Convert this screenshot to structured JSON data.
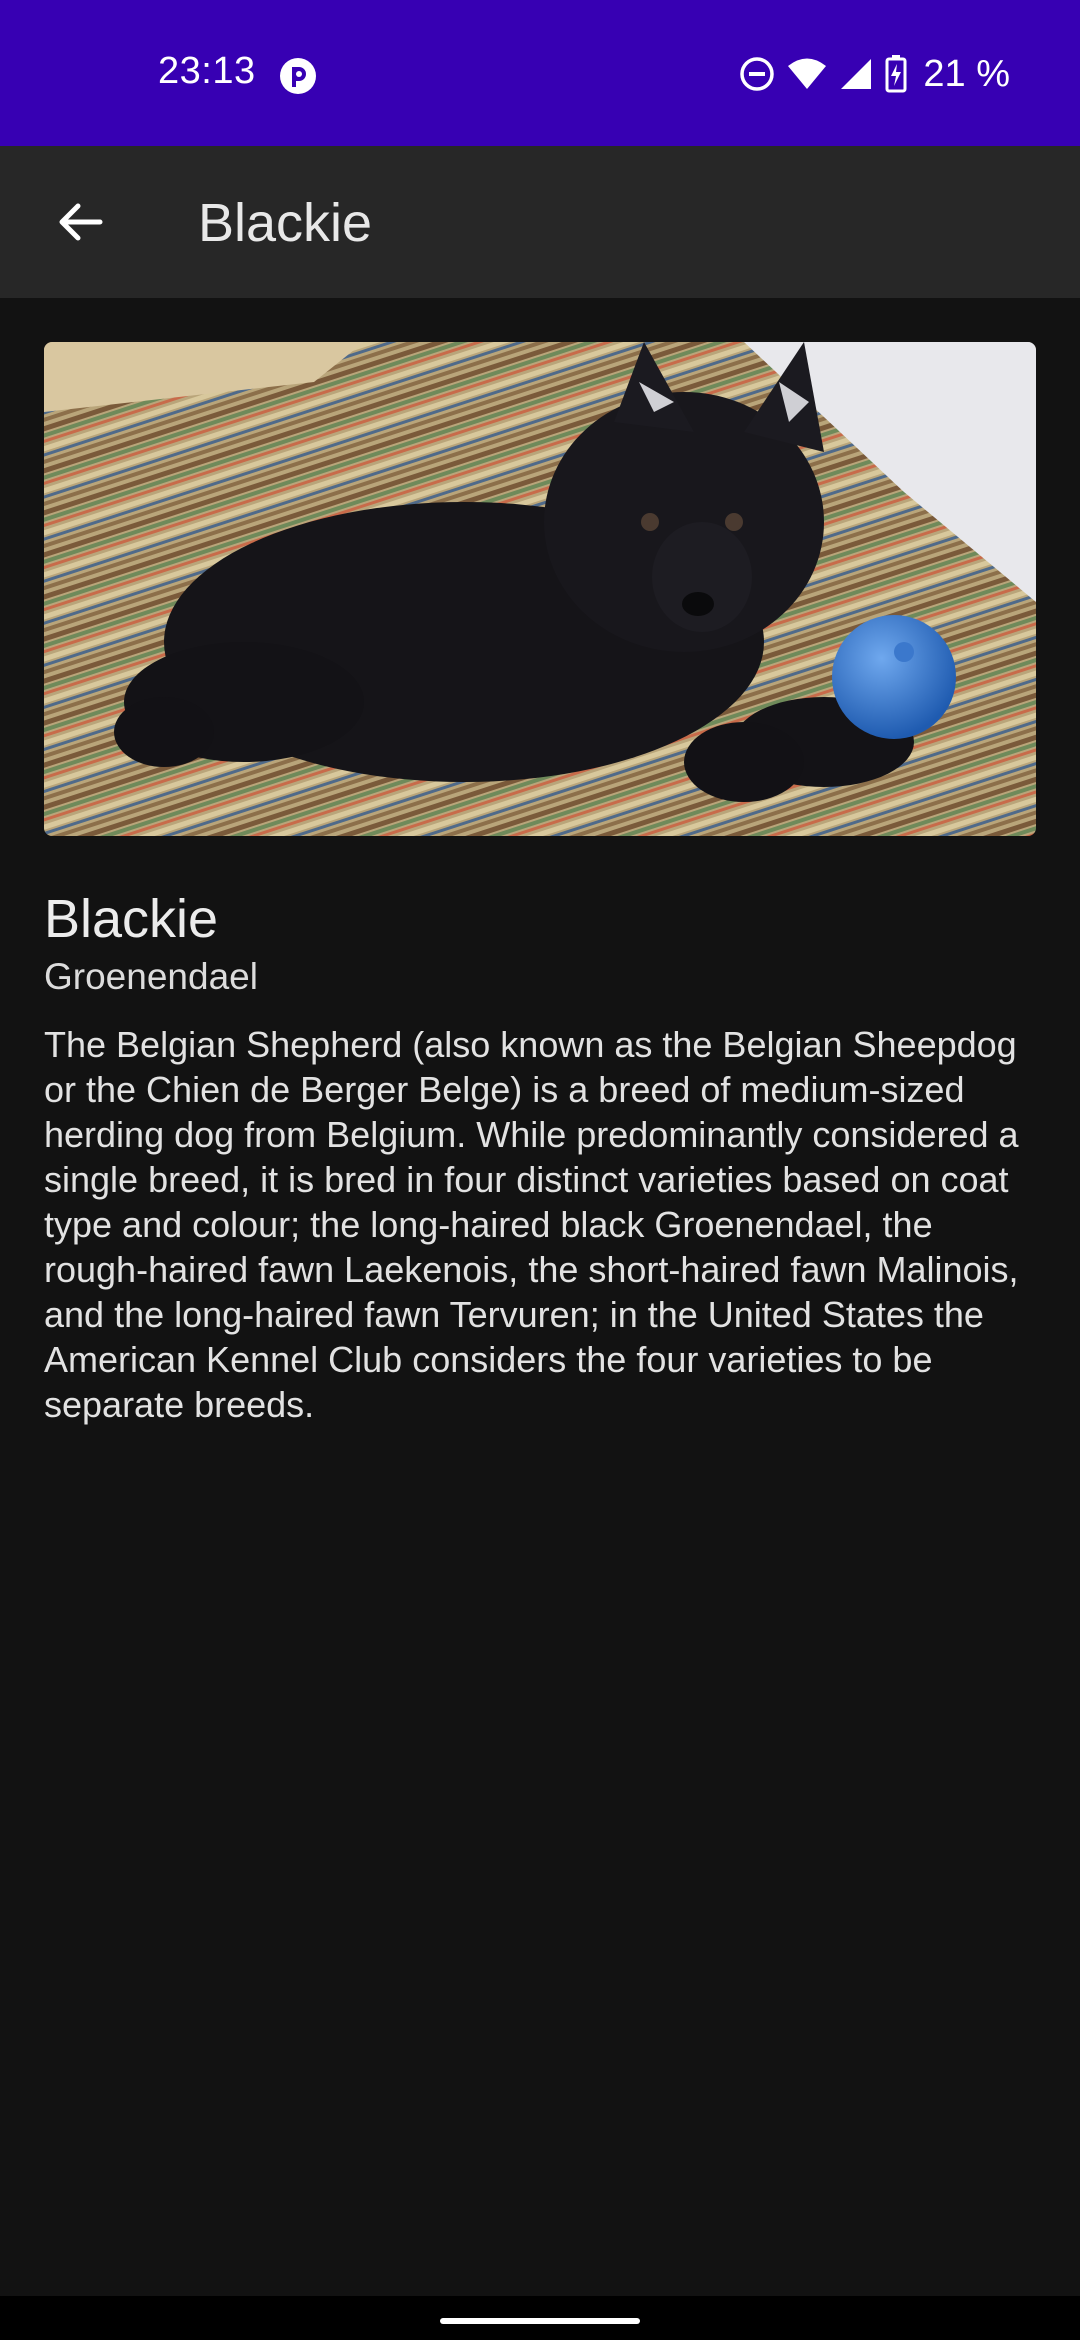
{
  "status_bar": {
    "time": "23:13",
    "battery": "21 %",
    "background": "#3700b3",
    "icons": [
      "app-notification-icon",
      "do-not-disturb-icon",
      "wifi-icon",
      "cell-signal-icon",
      "battery-charging-icon"
    ]
  },
  "app_bar": {
    "title": "Blackie",
    "back_icon": "arrow-back-icon"
  },
  "detail": {
    "photo_subject": "black puppy lying on striped rug with a blue ball",
    "name": "Blackie",
    "breed": "Groenendael",
    "description": "The Belgian Shepherd (also known as the Belgian Sheepdog or the Chien de Berger Belge) is a breed of medium-sized herding dog from Belgium. While predominantly considered a single breed, it is bred in four distinct varieties based on coat type and colour; the long-haired black Groenendael, the rough-haired fawn Laekenois, the short-haired fawn Malinois, and the long-haired fawn Tervuren; in the United States the American Kennel Club considers the four varieties to be separate breeds."
  }
}
